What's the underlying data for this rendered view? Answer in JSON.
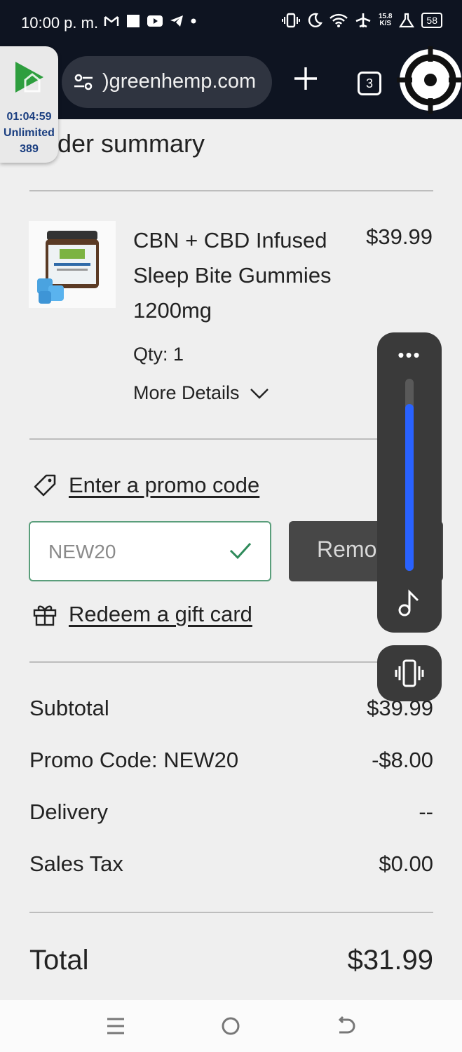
{
  "status_bar": {
    "time": "10:00 p. m.",
    "net_speed_value": "15.8",
    "net_speed_unit": "K/S",
    "battery": "58",
    "icons": [
      "gmail-icon",
      "square-icon",
      "youtube-icon",
      "telegram-icon",
      "dot-icon",
      "vibrate-icon",
      "moon-icon",
      "wifi-icon",
      "airplane-icon",
      "lab-icon",
      "battery-icon"
    ]
  },
  "browser": {
    "url": "greenhemp.com",
    "url_visible": ")greenhemp.com",
    "tab_count": "3"
  },
  "timer_widget": {
    "clock": "01:04:59",
    "plan": "Unlimited",
    "count": "389"
  },
  "page": {
    "heading": "Order summary",
    "heading_visible": "rder summary"
  },
  "product": {
    "name": "CBN + CBD Infused Sleep Bite Gummies 1200mg",
    "price": "$39.99",
    "qty": "Qty: 1",
    "more_details": "More Details"
  },
  "promo": {
    "link": "Enter a promo code",
    "value": "NEW20",
    "remove_label": "Remove",
    "remove_visible": "Remo"
  },
  "gift": {
    "link": "Redeem a gift card"
  },
  "summary": {
    "rows": [
      {
        "label": "Subtotal",
        "value": "$39.99"
      },
      {
        "label": "Promo Code: NEW20",
        "value": "-$8.00"
      },
      {
        "label": "Delivery",
        "value": "--"
      },
      {
        "label": "Sales Tax",
        "value": "$0.00"
      }
    ],
    "total_label": "Total",
    "total_value": "$31.99"
  },
  "volume": {
    "level": 0.87,
    "accent": "#2962ff"
  },
  "colors": {
    "status_bg": "#0e1421",
    "page_bg": "#efefef",
    "promo_border": "#5a9e7b",
    "remove_bg": "#474747"
  }
}
